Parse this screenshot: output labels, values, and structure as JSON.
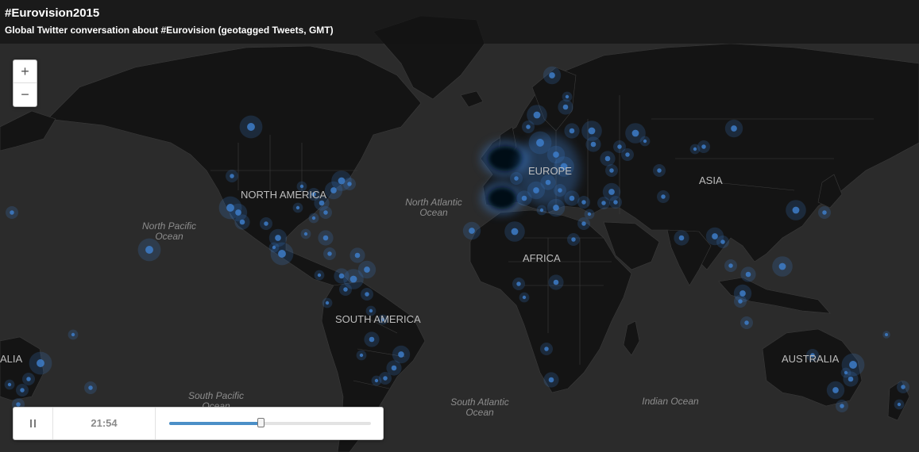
{
  "header": {
    "title": "#Eurovision2015",
    "subtitle": "Global Twitter conversation about #Eurovision (geotagged Tweets, GMT)"
  },
  "zoom": {
    "in_label": "+",
    "out_label": "−"
  },
  "player": {
    "time": "21:54",
    "progress": 0.455,
    "state": "playing"
  },
  "labels": {
    "continents": {
      "north_america": "NORTH AMERICA",
      "south_america": "SOUTH AMERICA",
      "europe": "EUROPE",
      "africa": "AFRICA",
      "asia": "ASIA",
      "australia": "AUSTRALIA",
      "australia_left": "ALIA"
    },
    "oceans": {
      "north_atlantic_1": "North Atlantic",
      "north_atlantic_2": "Ocean",
      "north_pacific_1": "North Pacific",
      "north_pacific_2": "Ocean",
      "south_pacific_1": "South Pacific",
      "south_pacific_2": "Ocean",
      "south_atlantic_1": "South Atlantic",
      "south_atlantic_2": "Ocean",
      "indian": "Indian Ocean"
    }
  },
  "colors": {
    "water": "#2b2b2b",
    "land": "#131313",
    "borders": "#3a3a3a",
    "tweet_dot": "#3d7cc9",
    "hotspot": "#000814"
  }
}
